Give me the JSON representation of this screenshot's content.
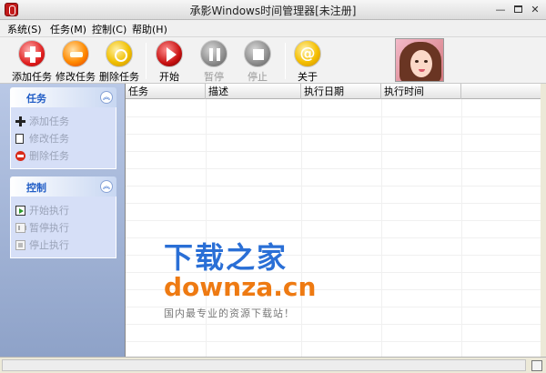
{
  "window": {
    "title": "承影Windows时间管理器[未注册]",
    "controls": {
      "minimize": "—",
      "close": "✕"
    }
  },
  "menu": [
    {
      "label": "系统(S)"
    },
    {
      "label": "任务(M)"
    },
    {
      "label": "控制(C)"
    },
    {
      "label": "帮助(H)"
    }
  ],
  "toolbar": {
    "add_task": "添加任务",
    "edit_task": "修改任务",
    "delete_task": "删除任务",
    "start": "开始",
    "pause": "暂停",
    "stop": "停止",
    "about": "关于",
    "about_symbol": "@"
  },
  "sidebar": {
    "tasks_group": {
      "title": "任务",
      "toggle": "︽",
      "items": [
        {
          "label": "添加任务",
          "icon": "plus-icon"
        },
        {
          "label": "修改任务",
          "icon": "edit-document-icon"
        },
        {
          "label": "删除任务",
          "icon": "remove-circle-icon"
        }
      ]
    },
    "control_group": {
      "title": "控制",
      "toggle": "︽",
      "items": [
        {
          "label": "开始执行",
          "icon": "play-icon"
        },
        {
          "label": "暂停执行",
          "icon": "pause-icon"
        },
        {
          "label": "停止执行",
          "icon": "stop-icon"
        }
      ]
    }
  },
  "table": {
    "columns": [
      "任务",
      "描述",
      "执行日期",
      "执行时间"
    ],
    "rows": []
  },
  "watermark": {
    "main": "下载之家",
    "domain": "downza.cn",
    "slogan": "国内最专业的资源下载站！"
  },
  "colors": {
    "sidebar_header_text": "#215dc6",
    "watermark_blue": "#2a6fd6",
    "watermark_orange": "#ee7a12",
    "disabled_text": "#9aa3b8"
  }
}
